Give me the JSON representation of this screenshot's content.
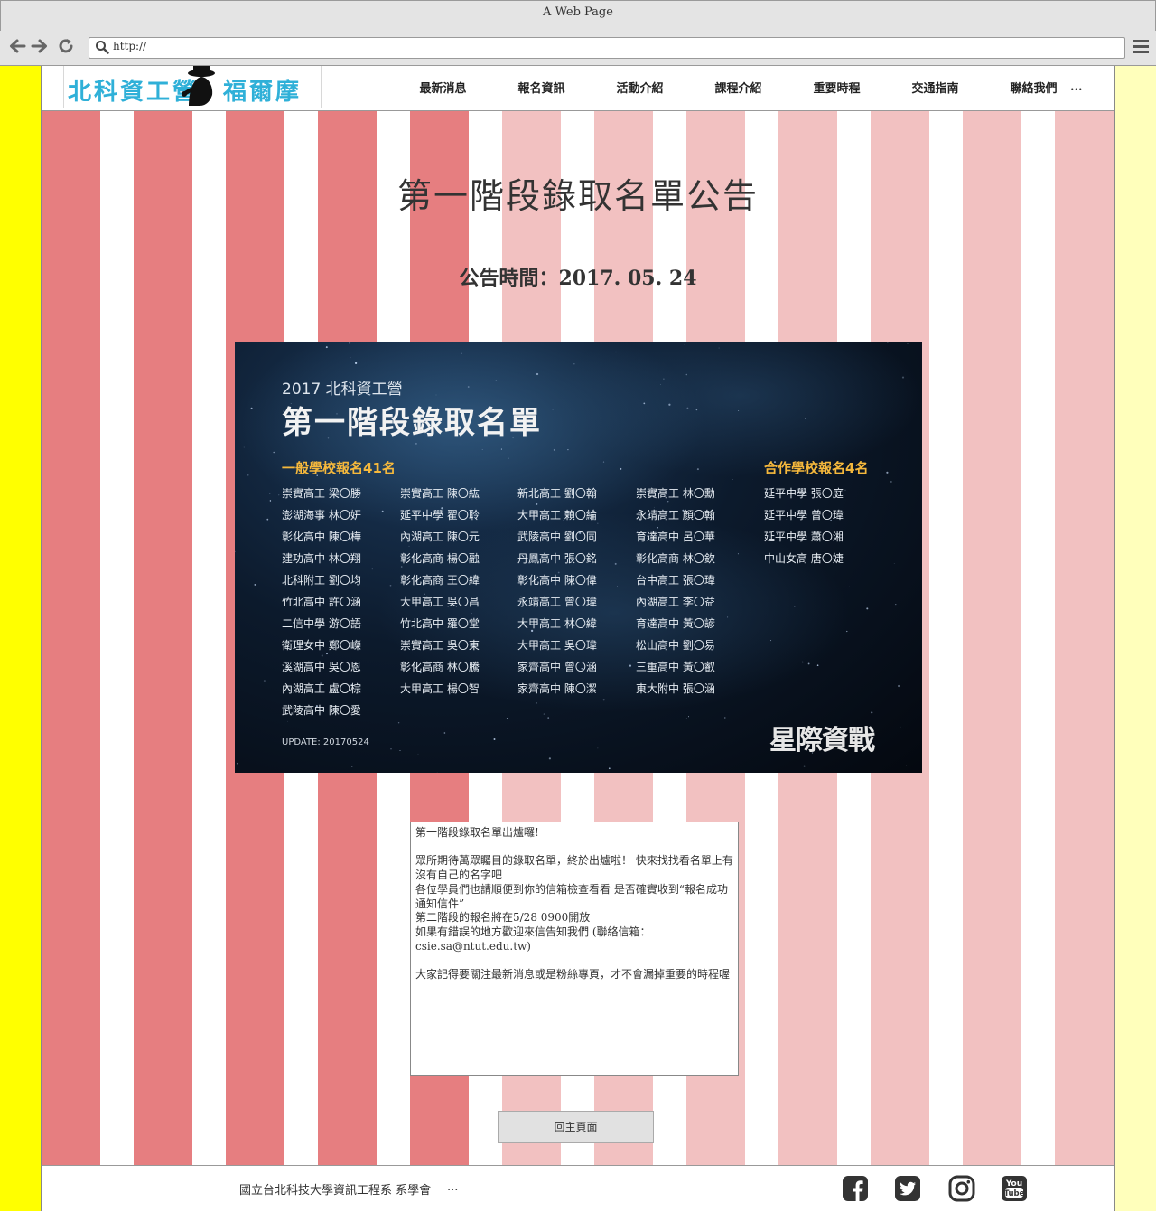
{
  "browser": {
    "title": "A Web Page",
    "url": "http://"
  },
  "header": {
    "logo_left": "北科資工營",
    "logo_right": "福爾摩資",
    "menu": [
      "最新消息",
      "報名資訊",
      "活動介紹",
      "課程介紹",
      "重要時程",
      "交通指南",
      "聯絡我們"
    ],
    "menu_more": "..."
  },
  "main": {
    "title": "第一階段錄取名單公告",
    "date": "公告時間：2017. 05. 24"
  },
  "poster": {
    "subtitle": "2017 北科資工營",
    "title": "第一階段錄取名單",
    "section_general": "一般學校報名41名",
    "section_partner": "合作學校報名4名",
    "columns": [
      [
        "崇實高工 梁〇勝",
        "澎湖海事 林〇妍",
        "彰化高中 陳〇樺",
        "建功高中 林〇翔",
        "北科附工 劉〇均",
        "竹北高中 許〇涵",
        "二信中學 游〇語",
        "衛理女中 鄭〇嶸",
        "溪湖高中 吳〇恩",
        "內湖高工 盧〇棕",
        "武陵高中 陳〇愛"
      ],
      [
        "崇實高工 陳〇紘",
        "延平中學 翟〇聆",
        "內湖高工 陳〇元",
        "彰化高商 楊〇融",
        "彰化高商 王〇緯",
        "大甲高工 吳〇昌",
        "竹北高中 羅〇堂",
        "崇實高工 吳〇東",
        "彰化高商 林〇騰",
        "大甲高工 楊〇智"
      ],
      [
        "新北高工 劉〇翰",
        "大甲高工 賴〇綸",
        "武陵高中 劉〇同",
        "丹鳳高中 張〇銘",
        "彰化高中 陳〇偉",
        "永靖高工 曾〇瑋",
        "大甲高工 林〇緯",
        "大甲高工 吳〇瑋",
        "家齊高中 曾〇涵",
        "家齊高中 陳〇潔"
      ],
      [
        "崇實高工 林〇勳",
        "永靖高工 顏〇翰",
        "育達高中 呂〇華",
        "彰化高商 林〇欽",
        "台中高工 張〇瑋",
        "內湖高工 李〇益",
        "育達高中 黃〇諺",
        "松山高中 劉〇易",
        "三重高中 黃〇叡",
        "東大附中 張〇涵"
      ],
      [
        "延平中學 張〇庭",
        "延平中學 曾〇瑋",
        "延平中學 蕭〇湘",
        "中山女高 唐〇婕"
      ]
    ],
    "update": "UPDATE: 20170524",
    "brand": "星際資戰"
  },
  "message": {
    "lines": [
      "第一階段錄取名單出爐囉!",
      "",
      "眾所期待萬眾矚目的錄取名單，終於出爐啦！ 快來找找看名單上有沒有自己的名字吧",
      "各位學員們也請順便到你的信箱檢查看看 是否確實收到“報名成功通知信件”",
      "第二階段的報名將在5/28 0900開放",
      "如果有錯誤的地方歡迎來信告知我們 (聯絡信箱：csie.sa@ntut.edu.tw)",
      "",
      "大家記得要關注最新消息或是粉絲專頁，才不會漏掉重要的時程喔"
    ]
  },
  "back_button": "回主頁面",
  "footer": {
    "text": "國立台北科技大學資訊工程系 系學會",
    "more": "...",
    "social": [
      "facebook-icon",
      "twitter-icon",
      "instagram-icon",
      "youtube-icon"
    ]
  },
  "colors": {
    "stripe_dark": "#e67e80",
    "stripe_light": "#f2c1c1",
    "left_sidebar": "#ffff00",
    "right_sidebar": "#ffffbb",
    "poster_accent": "#f5b83c",
    "logo_blue": "#2fb0d8"
  }
}
